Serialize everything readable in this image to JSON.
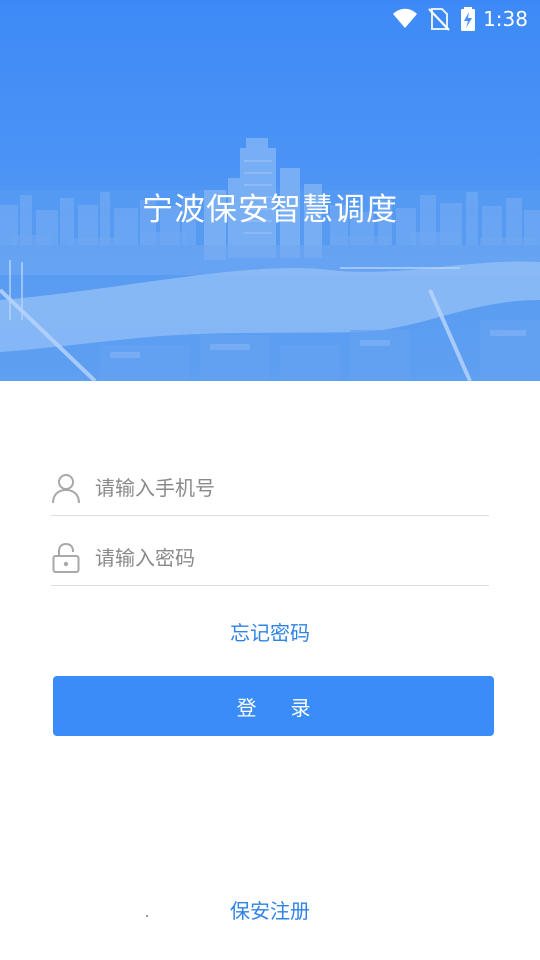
{
  "status_bar": {
    "time": "1:38",
    "icons": [
      "wifi-icon",
      "no-sim-icon",
      "battery-charging-icon"
    ]
  },
  "hero": {
    "title": "宁波保安智慧调度"
  },
  "login_form": {
    "phone": {
      "icon": "person-icon",
      "placeholder": "请输入手机号",
      "value": ""
    },
    "password": {
      "icon": "lock-icon",
      "placeholder": "请输入密码",
      "value": ""
    },
    "forgot_password_label": "忘记密码",
    "login_button_label": "登录"
  },
  "footer": {
    "register_label": "保安注册"
  },
  "colors": {
    "primary": "#3a8cf8",
    "link": "#2f83e6",
    "hero_top": "#3d8af7",
    "divider": "#dcdcdc"
  }
}
